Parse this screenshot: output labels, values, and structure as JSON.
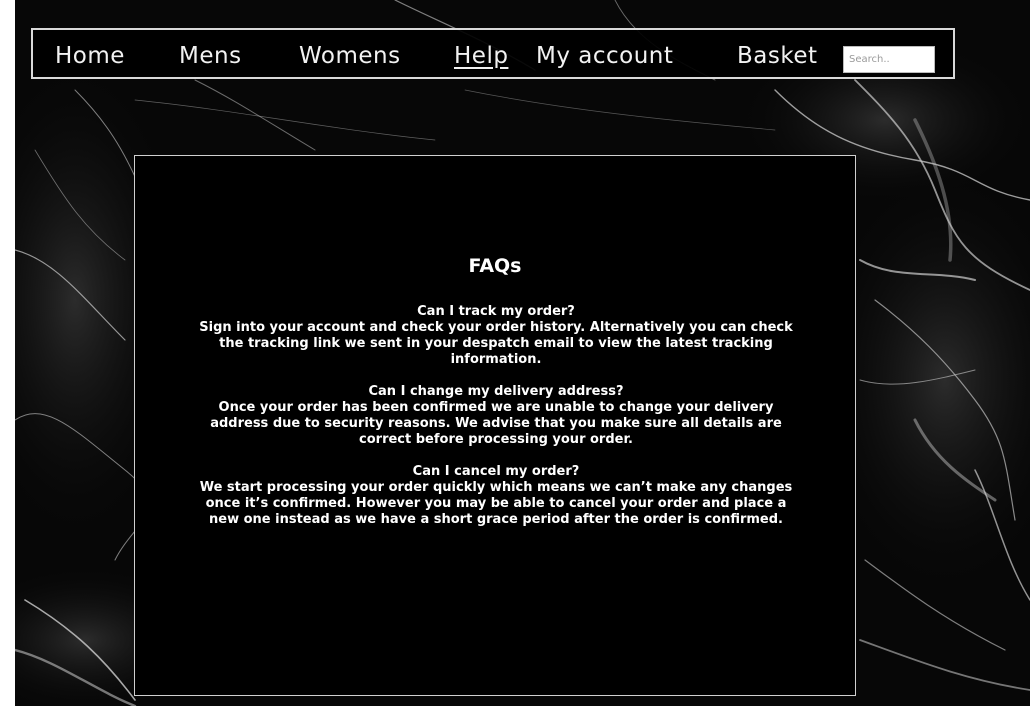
{
  "nav": {
    "items": [
      {
        "label": "Home",
        "active": false
      },
      {
        "label": "Mens",
        "active": false
      },
      {
        "label": "Womens",
        "active": false
      },
      {
        "label": "Help",
        "active": true
      },
      {
        "label": "My account",
        "active": false
      },
      {
        "label": "Basket",
        "active": false
      }
    ],
    "search_placeholder": "Search.."
  },
  "faq": {
    "title": "FAQs",
    "items": [
      {
        "question": "Can I track my order?",
        "answer": "Sign into your account and check your order history. Alternatively you can check the tracking link we sent in your despatch email to view the latest tracking information."
      },
      {
        "question": "Can I change my delivery address?",
        "answer": "Once your order has been confirmed we are unable to change your delivery address due to security reasons. We advise that you make sure all details are correct before processing your order."
      },
      {
        "question": "Can I cancel my order?",
        "answer": "We start processing your order quickly which means we can’t make any changes once it’s confirmed. However you may be able to cancel your order and place a new one instead as we have a short grace period after the order is confirmed."
      }
    ]
  },
  "colors": {
    "background": "#0a0a0a",
    "marble_veins": "#cfcfcf",
    "text": "#ffffff",
    "nav_border": "#d9d9d9"
  }
}
